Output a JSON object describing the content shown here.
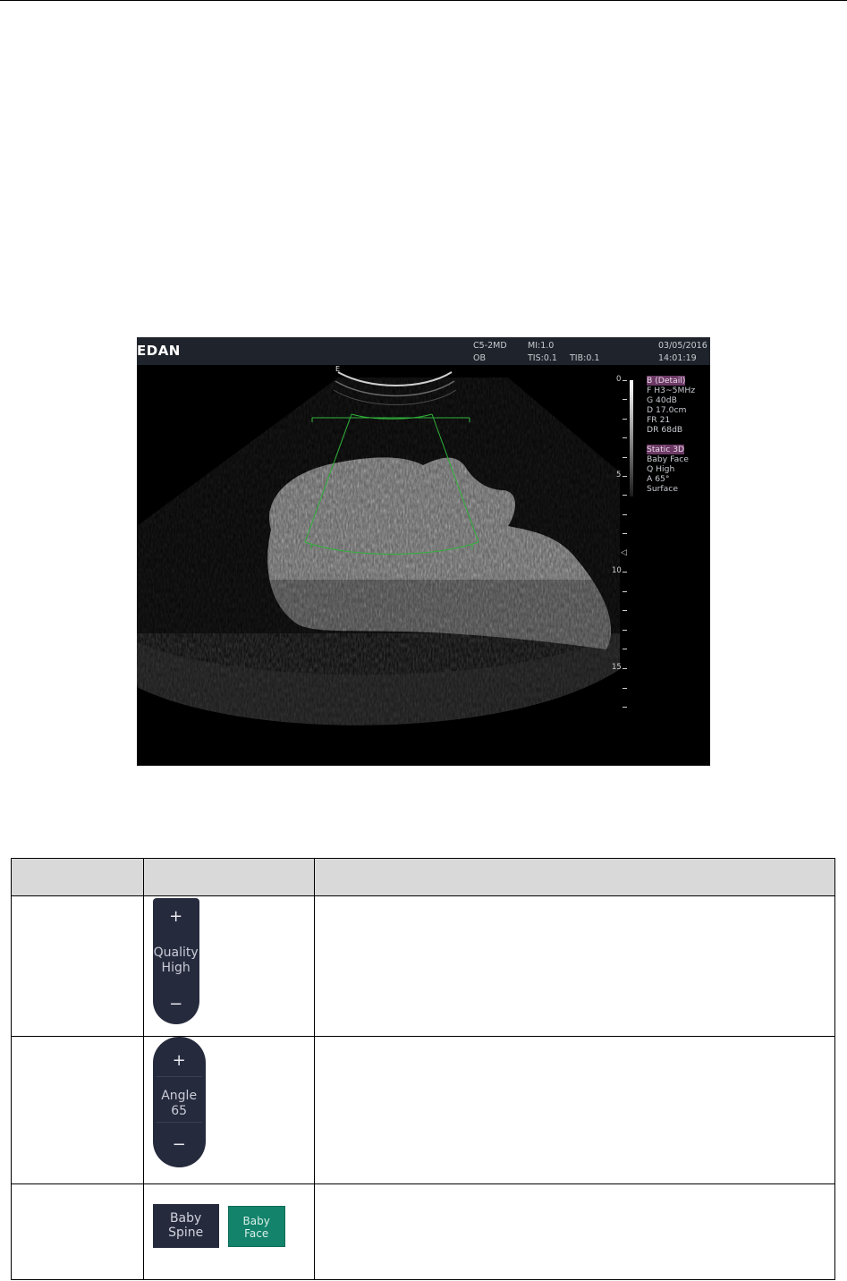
{
  "ultrasound": {
    "brand": "EDAN",
    "probe": "C5-2MD",
    "exam": "OB",
    "mi": "MI:1.0",
    "tis": "TIS:0.1",
    "tib": "TIB:0.1",
    "date": "03/05/2016",
    "time": "14:01:19",
    "orientation_marker": "E",
    "depth_labels": [
      "0",
      "5",
      "10",
      "15"
    ],
    "params_b": {
      "mode": "B (Detail)",
      "freq": "F H3~5MHz",
      "gain": "G 40dB",
      "depth": "D 17.0cm",
      "frame_rate": "FR 21",
      "dyn_range": "DR 68dB"
    },
    "params_3d": {
      "mode": "Static 3D",
      "preset": "Baby Face",
      "quality": "Q High",
      "angle": "A 65°",
      "render": "Surface"
    }
  },
  "table": {
    "header": [
      "",
      "",
      ""
    ],
    "quality_control": {
      "plus": "+",
      "label_line1": "Quality",
      "label_line2": "High",
      "minus": "−"
    },
    "angle_control": {
      "plus": "+",
      "label_line1": "Angle",
      "label_line2": "65",
      "minus": "−"
    },
    "preset_buttons": {
      "spine_line1": "Baby",
      "spine_line2": "Spine",
      "face_line1": "Baby",
      "face_line2": "Face"
    }
  }
}
